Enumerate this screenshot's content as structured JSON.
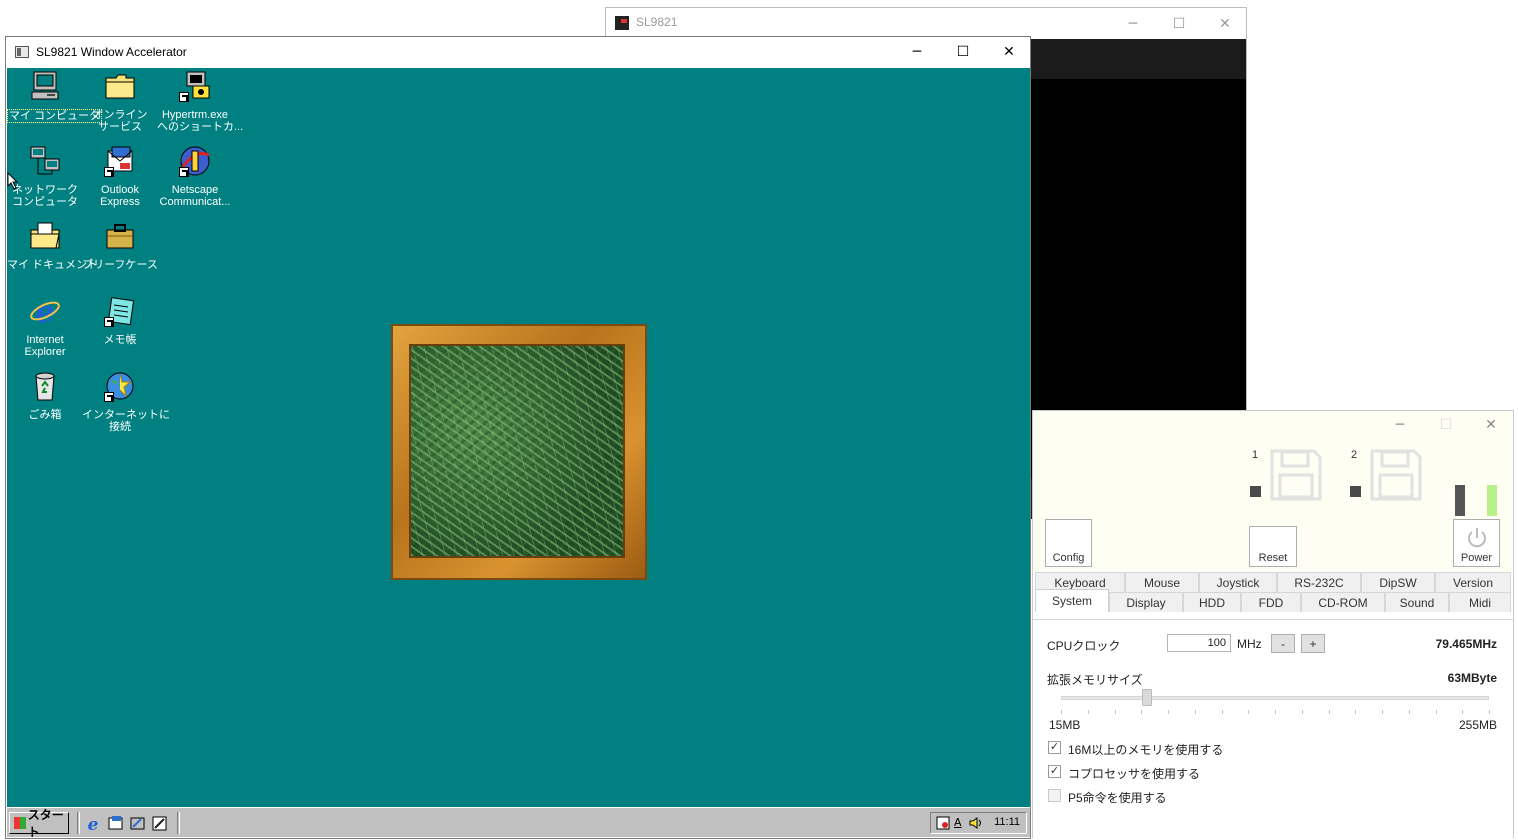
{
  "back_window": {
    "title": "SL9821"
  },
  "main_window": {
    "title": "SL9821 Window Accelerator"
  },
  "window_controls": {
    "minimize": "─",
    "maximize": "☐",
    "close": "✕"
  },
  "desktop": {
    "background": "#008080",
    "icons": [
      {
        "name": "my-computer",
        "label": "マイ コンピュータ"
      },
      {
        "name": "online-services",
        "label": "オンライン\nサービス"
      },
      {
        "name": "hypertrm-shortcut",
        "label": "Hypertrm.exe\nへのショートカ..."
      },
      {
        "name": "network-computer",
        "label": "ネットワーク\nコンピュータ"
      },
      {
        "name": "outlook-express",
        "label": "Outlook\nExpress"
      },
      {
        "name": "netscape",
        "label": "Netscape\nCommunicat..."
      },
      {
        "name": "my-documents",
        "label": "マイ ドキュメント"
      },
      {
        "name": "briefcase",
        "label": "ブリーフケース"
      },
      {
        "name": "internet-explorer",
        "label": "Internet\nExplorer"
      },
      {
        "name": "notepad",
        "label": "メモ帳"
      },
      {
        "name": "recycle-bin",
        "label": "ごみ箱"
      },
      {
        "name": "connect-internet",
        "label": "インターネットに\n接続"
      }
    ]
  },
  "taskbar": {
    "start_label": "スタート",
    "clock": "11:11",
    "ime": "A"
  },
  "panel": {
    "drive1": "1",
    "drive2": "2",
    "buttons": {
      "config": "Config",
      "reset": "Reset",
      "power": "Power"
    },
    "tabs_row1": [
      "Keyboard",
      "Mouse",
      "Joystick",
      "RS-232C",
      "DipSW",
      "Version"
    ],
    "tabs_row2": [
      "System",
      "Display",
      "HDD",
      "FDD",
      "CD-ROM",
      "Sound",
      "Midi"
    ],
    "active_tab": "System",
    "system": {
      "cpu_label": "CPUクロック",
      "cpu_value": "100",
      "cpu_unit": "MHz",
      "minus": "-",
      "plus": "+",
      "cpu_actual": "79.465MHz",
      "mem_label": "拡張メモリサイズ",
      "mem_value": "63MByte",
      "mem_min": "15MB",
      "mem_max": "255MB",
      "mem_slider_fraction": 0.2,
      "options": [
        {
          "label": "16M以上のメモリを使用する",
          "checked": true,
          "enabled": true
        },
        {
          "label": "コプロセッサを使用する",
          "checked": true,
          "enabled": true
        },
        {
          "label": "P5命令を使用する",
          "checked": false,
          "enabled": false
        }
      ]
    }
  }
}
